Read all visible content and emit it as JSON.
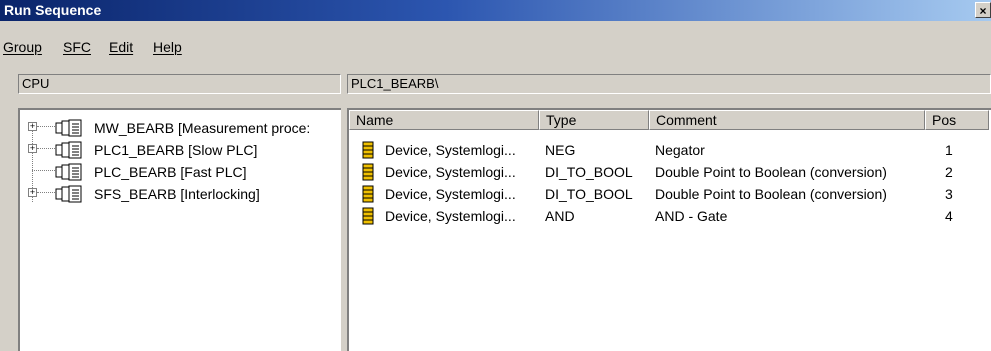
{
  "window": {
    "title": "Run Sequence",
    "close_glyph": "×"
  },
  "menu": [
    {
      "label": "Group"
    },
    {
      "label": "SFC"
    },
    {
      "label": "Edit"
    },
    {
      "label": "Help"
    }
  ],
  "left_panel": {
    "header": "CPU"
  },
  "tree": [
    {
      "expander": "+",
      "label": "MW_BEARB  [Measurement proce:"
    },
    {
      "expander": "+",
      "label": "PLC1_BEARB  [Slow PLC]"
    },
    {
      "expander": "",
      "label": "PLC_BEARB  [Fast PLC]"
    },
    {
      "expander": "+",
      "label": "SFS_BEARB  [Interlocking]"
    }
  ],
  "right_panel": {
    "header": "PLC1_BEARB\\"
  },
  "columns": [
    {
      "label": "Name"
    },
    {
      "label": "Type"
    },
    {
      "label": "Comment"
    },
    {
      "label": "Pos"
    }
  ],
  "rows": [
    {
      "name": "Device, Systemlogi...",
      "type": "NEG",
      "comment": "Negator",
      "pos": "1"
    },
    {
      "name": "Device, Systemlogi...",
      "type": "DI_TO_BOOL",
      "comment": "Double Point to Boolean (conversion)",
      "pos": "2"
    },
    {
      "name": "Device, Systemlogi...",
      "type": "DI_TO_BOOL",
      "comment": "Double Point to Boolean (conversion)",
      "pos": "3"
    },
    {
      "name": "Device, Systemlogi...",
      "type": "AND",
      "comment": "AND - Gate",
      "pos": "4"
    }
  ],
  "icons": {
    "tree_item": "program-block-icon",
    "list_item": "function-block-icon"
  },
  "colors": {
    "title_bar": "#0a246a",
    "window_bg": "#d4d0c8",
    "pane_bg": "#ffffff"
  }
}
